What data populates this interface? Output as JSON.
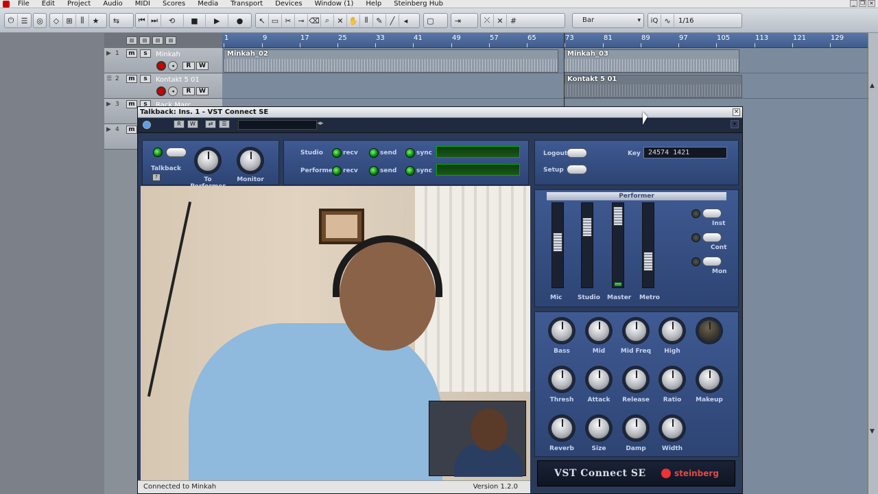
{
  "menu": [
    "File",
    "Edit",
    "Project",
    "Audio",
    "MIDI",
    "Scores",
    "Media",
    "Transport",
    "Devices",
    "Window (1)",
    "Help",
    "Steinberg Hub"
  ],
  "toolbar": {
    "quantize_mode": "Bar",
    "quantize_value": "1/16",
    "iq_label": "iQ"
  },
  "ruler": [
    "1",
    "9",
    "17",
    "25",
    "33",
    "41",
    "49",
    "57",
    "65",
    "73",
    "81",
    "89",
    "97",
    "105",
    "113",
    "121",
    "129"
  ],
  "tracks": [
    {
      "num": "1",
      "name": "Minkah",
      "m": "m",
      "s": "s",
      "r": "R",
      "w": "W"
    },
    {
      "num": "2",
      "name": "Kontakt 5 01",
      "m": "m",
      "s": "s",
      "r": "R",
      "w": "W"
    },
    {
      "num": "3",
      "name": "Rack Marc",
      "m": "m",
      "s": "s"
    },
    {
      "num": "4",
      "name": "",
      "m": "m",
      "s": "s"
    }
  ],
  "events": [
    {
      "label": "Minkah_02"
    },
    {
      "label": "Minkah_03"
    },
    {
      "label": "Kontakt 5 01"
    }
  ],
  "plugin": {
    "title": "Talkback: Ins. 1 - VST Connect SE",
    "talkback": {
      "label": "Talkback",
      "to_performer": "To Performer",
      "monitor": "Monitor"
    },
    "net": {
      "studio": "Studio",
      "performer": "Performer",
      "recv": "recv",
      "send": "send",
      "sync": "sync"
    },
    "auth": {
      "logout": "Logout",
      "setup": "Setup",
      "key_label": "Key",
      "key_value": "24574 1421"
    },
    "performer_header": "Performer",
    "faders": [
      "Mic",
      "Studio",
      "Master",
      "Metro"
    ],
    "fader_levels": [
      0.55,
      0.78,
      0.95,
      0.25
    ],
    "meter_levels": [
      0,
      0,
      0.04,
      0
    ],
    "toggles": [
      "Inst",
      "Cont",
      "Mon"
    ],
    "eq": [
      "Bass",
      "Mid",
      "Mid Freq",
      "High"
    ],
    "comp": [
      "Thresh",
      "Attack",
      "Release",
      "Ratio",
      "Makeup"
    ],
    "fx": [
      "Reverb",
      "Size",
      "Damp",
      "Width"
    ],
    "status_left": "Connected to Minkah",
    "status_right": "Version 1.2.0",
    "brand_left": "VST Connect SE",
    "brand_right": "steinberg"
  },
  "colors": {
    "accent": "#3f5a93",
    "record": "#cc0000",
    "led": "#2bd42b",
    "ruler": "#4a68a0"
  }
}
